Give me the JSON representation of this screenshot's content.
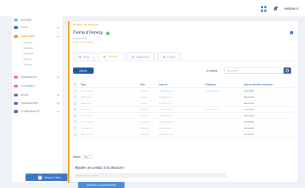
{
  "topbar": {
    "user_name": "Nathalie R."
  },
  "sidebar": {
    "items": [
      {
        "label": "ACCUEIL",
        "color": "#8fb3e0"
      },
      {
        "label": "DOCS",
        "color": "#3f74c6"
      },
      {
        "label": "ANNUAIRE",
        "color": "#f0a31c"
      },
      {
        "label": "PASSERELLE",
        "color": "#e8739c"
      },
      {
        "label": "CONTRATS",
        "color": "#e8739c"
      },
      {
        "label": "APPUI",
        "color": "#5b6fc7"
      },
      {
        "label": "TRANSFERTS",
        "color": "#7a5bc7"
      },
      {
        "label": "COMMUNAUTÉ",
        "color": "#3f74c6"
      }
    ],
    "subitems": [
      "Contacts",
      "Structures",
      "Adhérents",
      "Organes",
      "Groupes"
    ],
    "help_label": "Besoin d'aide",
    "help_glyph": "?"
  },
  "main": {
    "breadcrumb": "Modifier une structure",
    "title": "Ferme d'Annecy",
    "meta1": "ID structure 42",
    "meta2": "Supprimer la structure",
    "tabs": [
      "Infos",
      "Contacts",
      "Adhérents",
      "Projets"
    ],
    "add_button": "Ajouter",
    "count_text": "8 contacts",
    "search_placeholder": "Rechercher...",
    "columns": [
      "Nom",
      "Rôle",
      "Courriel",
      "Téléphone",
      "Date de dernière connexion"
    ],
    "rows": [
      [
        "Dupont Marie",
        "Gérante",
        "marie@ferme.fr",
        "04 50 12 34 56",
        "12/03/2023"
      ],
      [
        "Martin Jean",
        "Associé",
        "jean@ferme.fr",
        "",
        "05/02/2023"
      ],
      [
        "Bernard Luc",
        "Salarié",
        "luc@ferme.fr",
        "",
        "28/01/2023"
      ],
      [
        "Petit Anne",
        "Associée",
        "anne@ferme.fr",
        "06 11 22 33 44",
        "14/01/2023"
      ],
      [
        "Durand Paul",
        "Salarié",
        "paul@ferme.fr",
        "",
        "03/01/2023"
      ],
      [
        "Leroy Sophie",
        "Comptable",
        "sophie@ferme.fr",
        "",
        "20/12/2022"
      ],
      [
        "Moreau Éric",
        "Stagiaire",
        "eric@ferme.fr",
        "",
        "11/12/2022"
      ],
      [
        "Simon Claire",
        "Bénévole",
        "claire@ferme.fr",
        "",
        "02/12/2022"
      ]
    ],
    "show_label": "Afficher",
    "page_size": "10",
    "add_contact_title": "Ajouter un contact à la structure :",
    "add_contact_placeholder": "Rechercher un contact...",
    "add_contact_button": "AJOUTER À LA STRUCTURE"
  }
}
